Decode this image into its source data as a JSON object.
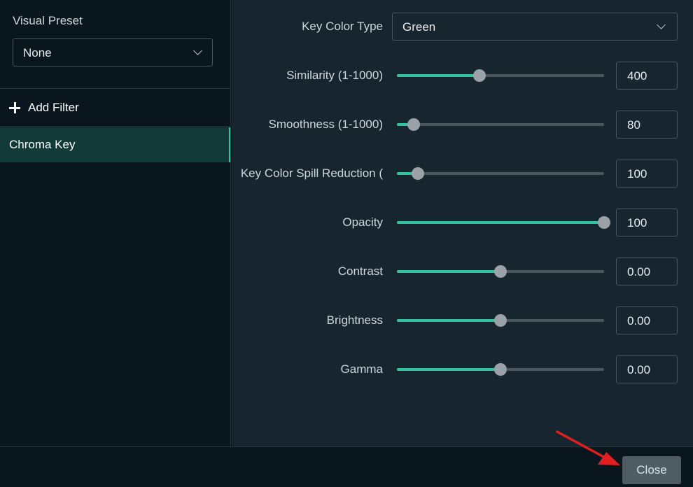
{
  "sidebar": {
    "visual_preset_label": "Visual Preset",
    "visual_preset_value": "None",
    "add_filter_label": "Add Filter",
    "filters": [
      {
        "label": "Chroma Key",
        "selected": true
      }
    ]
  },
  "settings": {
    "key_color_type": {
      "label": "Key Color Type",
      "value": "Green"
    },
    "sliders": [
      {
        "id": "similarity",
        "label": "Similarity (1-1000)",
        "value": "400",
        "fraction": 0.4
      },
      {
        "id": "smoothness",
        "label": "Smoothness (1-1000)",
        "value": "80",
        "fraction": 0.08
      },
      {
        "id": "spill",
        "label": "Key Color Spill Reduction (",
        "value": "100",
        "fraction": 0.1
      },
      {
        "id": "opacity",
        "label": "Opacity",
        "value": "100",
        "fraction": 1.0
      },
      {
        "id": "contrast",
        "label": "Contrast",
        "value": "0.00",
        "fraction": 0.5
      },
      {
        "id": "brightness",
        "label": "Brightness",
        "value": "0.00",
        "fraction": 0.5
      },
      {
        "id": "gamma",
        "label": "Gamma",
        "value": "0.00",
        "fraction": 0.5
      }
    ]
  },
  "footer": {
    "close_label": "Close"
  },
  "colors": {
    "accent": "#31c3a2",
    "annotation_arrow": "#e02020"
  },
  "icons": {
    "add": "plus-icon",
    "dropdown": "chevron-down-icon",
    "annotation": "red-arrow-icon"
  }
}
